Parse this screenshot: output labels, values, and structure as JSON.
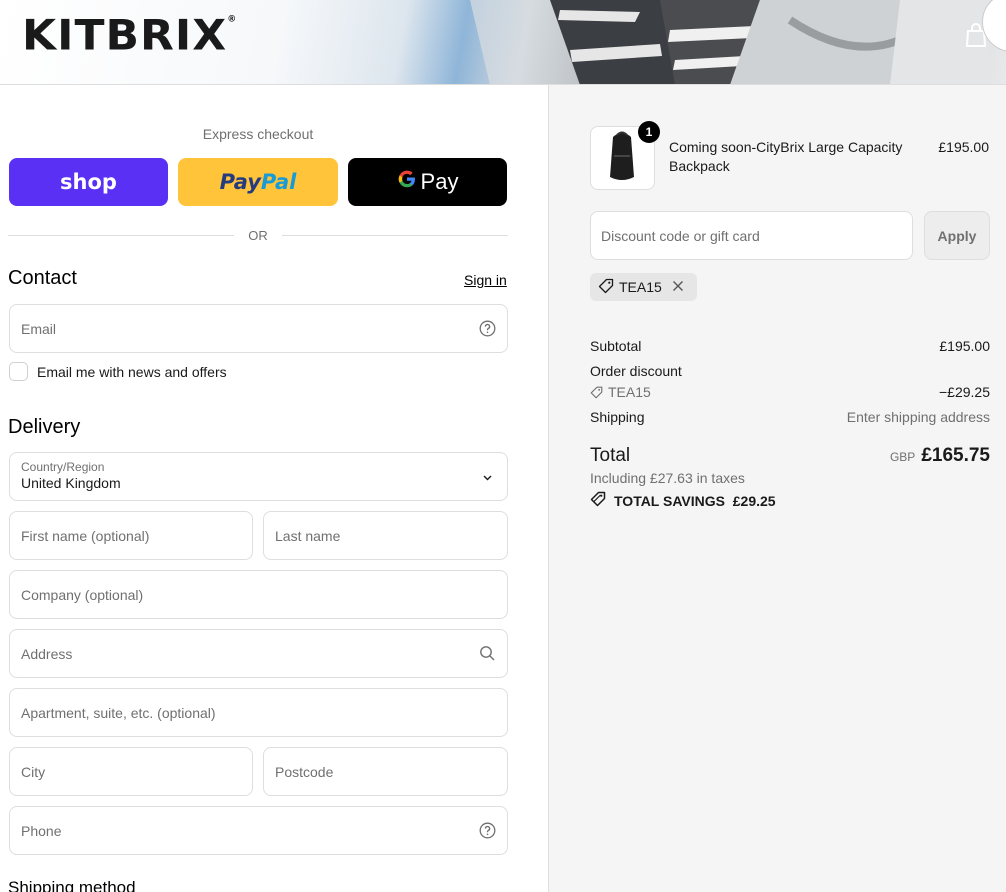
{
  "header": {
    "logo": "KITBRIX",
    "logo_mark": "®",
    "cart_icon": "shopping-bag-icon"
  },
  "express": {
    "label": "Express checkout",
    "shop_label": "shop",
    "paypal_pay": "Pay",
    "paypal_pal": "Pal",
    "gpay_g": "G",
    "gpay_label": "Pay",
    "or_label": "OR"
  },
  "contact": {
    "title": "Contact",
    "signin": "Sign in",
    "email_placeholder": "Email",
    "newsletter_label": "Email me with news and offers"
  },
  "delivery": {
    "title": "Delivery",
    "country_label": "Country/Region",
    "country_value": "United Kingdom",
    "first_name": "First name (optional)",
    "last_name": "Last name",
    "company": "Company (optional)",
    "address": "Address",
    "apartment": "Apartment, suite, etc. (optional)",
    "city": "City",
    "postcode": "Postcode",
    "phone": "Phone"
  },
  "shipping_method": {
    "title": "Shipping method"
  },
  "summary": {
    "product": {
      "name": "Coming soon-CityBrix Large Capacity Backpack",
      "price": "£195.00",
      "quantity": "1"
    },
    "discount_placeholder": "Discount code or gift card",
    "apply_label": "Apply",
    "applied_code": "TEA15",
    "subtotal_label": "Subtotal",
    "subtotal_value": "£195.00",
    "order_discount_label": "Order discount",
    "discount_code": "TEA15",
    "discount_value": "−£29.25",
    "shipping_label": "Shipping",
    "shipping_value": "Enter shipping address",
    "total_label": "Total",
    "total_currency": "GBP",
    "total_value": "£165.75",
    "taxes_note": "Including £27.63 in taxes",
    "savings_label": "TOTAL SAVINGS",
    "savings_value": "£29.25"
  }
}
